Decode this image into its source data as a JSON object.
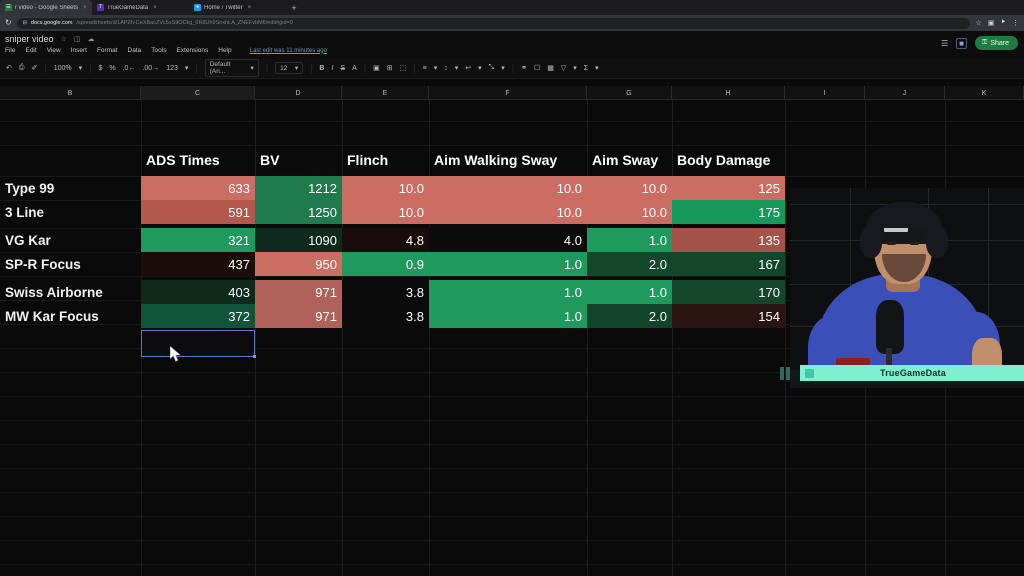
{
  "browser": {
    "tabs": [
      {
        "title": "r video - Google Sheets",
        "favicon": "sheets-icon",
        "active": true,
        "close": "×"
      },
      {
        "title": "TrueGameData",
        "favicon": "tgd-icon",
        "active": false,
        "close": "×"
      },
      {
        "title": "Home / Twitter",
        "favicon": "twitter-icon",
        "active": false,
        "close": "×"
      }
    ],
    "new_tab_label": "+",
    "reload_icon": "↻",
    "lock_icon": "⊟",
    "url_host": "docs.google.com",
    "url_path": "/spreadsheets/d/1APZh-CeXBacZVc5sS9OCkg_0R8Uh9SnxhLA_ZNEFvbM6/edit#gid=0",
    "omni_right_icons": [
      "☆",
      "▣",
      "⯈",
      "⋮"
    ]
  },
  "sheets": {
    "doc_title": "sniper video",
    "title_icons": [
      "star-icon",
      "move-icon",
      "cloud-icon"
    ],
    "menus": [
      "File",
      "Edit",
      "View",
      "Insert",
      "Format",
      "Data",
      "Tools",
      "Extensions",
      "Help"
    ],
    "last_edit": "Last edit was 11 minutes ago",
    "header_icons": [
      "comment-icon",
      "meet-icon"
    ],
    "share_label": "Share",
    "share_icon": "⚿",
    "share_color": "#1e7b42",
    "toolbar": {
      "undo": "↶",
      "redo": "↷",
      "print": "⎙",
      "paint": "✐",
      "zoom": "100%",
      "currency": "$",
      "percent": "%",
      "decimal_dec": ".0←",
      "decimal_inc": ".00→",
      "format_123": "123",
      "font": "Default (Ari...",
      "font_size": "12",
      "bold": "B",
      "italic": "I",
      "strike": "S",
      "text_color": "A",
      "fill_color": "▣",
      "borders": "⊞",
      "merge": "⬚",
      "align_h": "≡",
      "align_v": "↕",
      "wrap": "↩",
      "rotate": "⤡",
      "link": "⚭",
      "comment": "☐",
      "chart": "▦",
      "filter": "▽",
      "functions": "Σ",
      "chevron": "▾"
    }
  },
  "grid": {
    "column_headers": [
      "B",
      "C",
      "D",
      "E",
      "F",
      "G",
      "H",
      "I",
      "J",
      "K"
    ],
    "selected_column": "C",
    "selected_cell_ref": "C14"
  },
  "table": {
    "headers": [
      "",
      "ADS Times",
      "BV",
      "Flinch",
      "Aim Walking Sway",
      "Aim Sway",
      "Body Damage"
    ],
    "rows": [
      {
        "name": "Type 99",
        "values": [
          "633",
          "1212",
          "10.0",
          "10.0",
          "10.0",
          "125"
        ],
        "colors": [
          "#cc6d63",
          "#1f7a4d",
          "#cc6d63",
          "#cc6d63",
          "#cc6d63",
          "#cc6d63"
        ]
      },
      {
        "name": "3 Line",
        "values": [
          "591",
          "1250",
          "10.0",
          "10.0",
          "10.0",
          "175"
        ],
        "colors": [
          "#b4584f",
          "#1f7a4d",
          "#cc6d63",
          "#cc6d63",
          "#cc6d63",
          "#169a5b"
        ]
      },
      {
        "name": "VG Kar",
        "values": [
          "321",
          "1090",
          "4.8",
          "4.0",
          "1.0",
          "135"
        ],
        "colors": [
          "#1f9a5f",
          "#0e2a1c",
          "#1a0c0a",
          "#0b0b0b",
          "#1f9a5f",
          "#a4534a"
        ]
      },
      {
        "name": "SP-R Focus",
        "values": [
          "437",
          "950",
          "0.9",
          "1.0",
          "2.0",
          "167"
        ],
        "colors": [
          "#1c0d0c",
          "#cc6d63",
          "#1f9a5f",
          "#1f9a5f",
          "#14462c",
          "#14462c"
        ]
      },
      {
        "name": "Swiss Airborne",
        "values": [
          "403",
          "971",
          "3.8",
          "1.0",
          "1.0",
          "170"
        ],
        "colors": [
          "#0d2a1a",
          "#b0615a",
          "#0b0b0b",
          "#1f9a5f",
          "#1f9a5f",
          "#14462c"
        ]
      },
      {
        "name": "MW Kar Focus",
        "values": [
          "372",
          "971",
          "3.8",
          "1.0",
          "2.0",
          "154"
        ],
        "colors": [
          "#11543a",
          "#b0615a",
          "#0b0b0b",
          "#1f9a5f",
          "#12442c",
          "#2a1412"
        ]
      }
    ]
  },
  "webcam": {
    "banner_text": "TrueGameData",
    "banner_color": "#7ef0d0",
    "banner_icon": "stream-icon",
    "shirt_color": "#3a4fb8"
  }
}
